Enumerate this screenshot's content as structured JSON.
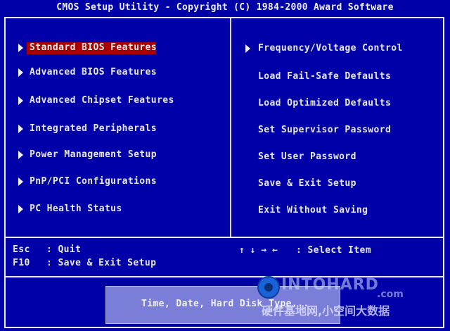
{
  "header": {
    "title": "CMOS Setup Utility - Copyright (C) 1984-2000 Award Software"
  },
  "menu_left": [
    {
      "label": "Standard BIOS Features",
      "selected": true
    },
    {
      "label": "Advanced BIOS Features"
    },
    {
      "label": "Advanced Chipset Features"
    },
    {
      "label": "Integrated Peripherals"
    },
    {
      "label": "Power Management Setup"
    },
    {
      "label": "PnP/PCI Configurations"
    },
    {
      "label": "PC Health Status"
    }
  ],
  "menu_right": [
    {
      "label": "Frequency/Voltage Control"
    },
    {
      "label": "Load Fail-Safe Defaults"
    },
    {
      "label": "Load Optimized Defaults"
    },
    {
      "label": "Set Supervisor Password"
    },
    {
      "label": "Set User Password"
    },
    {
      "label": "Save & Exit Setup"
    },
    {
      "label": "Exit Without Saving"
    }
  ],
  "help": {
    "esc_key": "Esc",
    "esc_action": ": Quit",
    "f10_key": "F10",
    "f10_action": ": Save & Exit Setup",
    "arrows": "↑ ↓ → ←",
    "select_action": ": Select Item"
  },
  "status": {
    "description": "Time, Date, Hard Disk Type..."
  },
  "watermark": {
    "brand": "INTOHARD",
    "suffix": ".com",
    "caption": "硬件基地网,小空间大数据"
  },
  "colors": {
    "background": "#0000a8",
    "highlight": "#a80000",
    "text": "#e8e8e8",
    "status_box": "#7a7ed8"
  }
}
